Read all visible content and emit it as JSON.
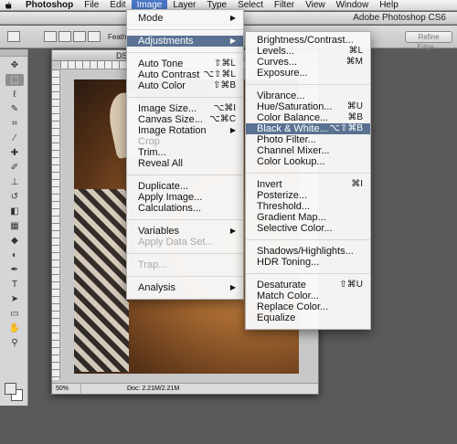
{
  "menubar": {
    "apple_icon": "apple-logo",
    "items": [
      "Photoshop",
      "File",
      "Edit",
      "Image",
      "Layer",
      "Type",
      "Select",
      "Filter",
      "View",
      "Window",
      "Help"
    ],
    "active_index": 3
  },
  "window": {
    "title": "Adobe Photoshop CS6"
  },
  "options": {
    "feather_label": "Feather:",
    "refine_label": "Refine Edge..."
  },
  "document": {
    "tab": "DS",
    "zoom": "50%",
    "info": "Doc: 2.21M/2.21M"
  },
  "image_menu": {
    "items": [
      {
        "label": "Mode",
        "submenu": true
      },
      {
        "sep": true
      },
      {
        "label": "Adjustments",
        "submenu": true,
        "highlighted": true
      },
      {
        "sep": true
      },
      {
        "label": "Auto Tone",
        "shortcut": "⇧⌘L"
      },
      {
        "label": "Auto Contrast",
        "shortcut": "⌥⇧⌘L"
      },
      {
        "label": "Auto Color",
        "shortcut": "⇧⌘B"
      },
      {
        "sep": true
      },
      {
        "label": "Image Size...",
        "shortcut": "⌥⌘I"
      },
      {
        "label": "Canvas Size...",
        "shortcut": "⌥⌘C"
      },
      {
        "label": "Image Rotation",
        "submenu": true
      },
      {
        "label": "Crop",
        "disabled": true
      },
      {
        "label": "Trim..."
      },
      {
        "label": "Reveal All"
      },
      {
        "sep": true
      },
      {
        "label": "Duplicate..."
      },
      {
        "label": "Apply Image..."
      },
      {
        "label": "Calculations..."
      },
      {
        "sep": true
      },
      {
        "label": "Variables",
        "submenu": true
      },
      {
        "label": "Apply Data Set...",
        "disabled": true
      },
      {
        "sep": true
      },
      {
        "label": "Trap...",
        "disabled": true
      },
      {
        "sep": true
      },
      {
        "label": "Analysis",
        "submenu": true
      }
    ]
  },
  "adjust_menu": {
    "items": [
      {
        "label": "Brightness/Contrast..."
      },
      {
        "label": "Levels...",
        "shortcut": "⌘L"
      },
      {
        "label": "Curves...",
        "shortcut": "⌘M"
      },
      {
        "label": "Exposure..."
      },
      {
        "sep": true
      },
      {
        "label": "Vibrance..."
      },
      {
        "label": "Hue/Saturation...",
        "shortcut": "⌘U"
      },
      {
        "label": "Color Balance...",
        "shortcut": "⌘B"
      },
      {
        "label": "Black & White...",
        "shortcut": "⌥⇧⌘B",
        "highlighted": true
      },
      {
        "label": "Photo Filter..."
      },
      {
        "label": "Channel Mixer..."
      },
      {
        "label": "Color Lookup..."
      },
      {
        "sep": true
      },
      {
        "label": "Invert",
        "shortcut": "⌘I"
      },
      {
        "label": "Posterize..."
      },
      {
        "label": "Threshold..."
      },
      {
        "label": "Gradient Map..."
      },
      {
        "label": "Selective Color..."
      },
      {
        "sep": true
      },
      {
        "label": "Shadows/Highlights..."
      },
      {
        "label": "HDR Toning..."
      },
      {
        "sep": true
      },
      {
        "label": "Desaturate",
        "shortcut": "⇧⌘U"
      },
      {
        "label": "Match Color..."
      },
      {
        "label": "Replace Color..."
      },
      {
        "label": "Equalize"
      }
    ]
  },
  "tools": [
    {
      "name": "move-tool-icon",
      "glyph": "✥"
    },
    {
      "name": "marquee-tool-icon",
      "glyph": "⬚",
      "selected": true
    },
    {
      "name": "lasso-tool-icon",
      "glyph": "ℓ"
    },
    {
      "name": "quick-select-tool-icon",
      "glyph": "✎"
    },
    {
      "name": "crop-tool-icon",
      "glyph": "⌗"
    },
    {
      "name": "eyedropper-tool-icon",
      "glyph": "⁄"
    },
    {
      "name": "healing-brush-tool-icon",
      "glyph": "✚"
    },
    {
      "name": "brush-tool-icon",
      "glyph": "✐"
    },
    {
      "name": "clone-stamp-tool-icon",
      "glyph": "⊥"
    },
    {
      "name": "history-brush-tool-icon",
      "glyph": "↺"
    },
    {
      "name": "eraser-tool-icon",
      "glyph": "◧"
    },
    {
      "name": "gradient-tool-icon",
      "glyph": "▦"
    },
    {
      "name": "blur-tool-icon",
      "glyph": "◆"
    },
    {
      "name": "dodge-tool-icon",
      "glyph": "◐"
    },
    {
      "name": "pen-tool-icon",
      "glyph": "✒"
    },
    {
      "name": "type-tool-icon",
      "glyph": "T"
    },
    {
      "name": "path-select-tool-icon",
      "glyph": "➤"
    },
    {
      "name": "shape-tool-icon",
      "glyph": "▭"
    },
    {
      "name": "hand-tool-icon",
      "glyph": "✋"
    },
    {
      "name": "zoom-tool-icon",
      "glyph": "⚲"
    }
  ]
}
